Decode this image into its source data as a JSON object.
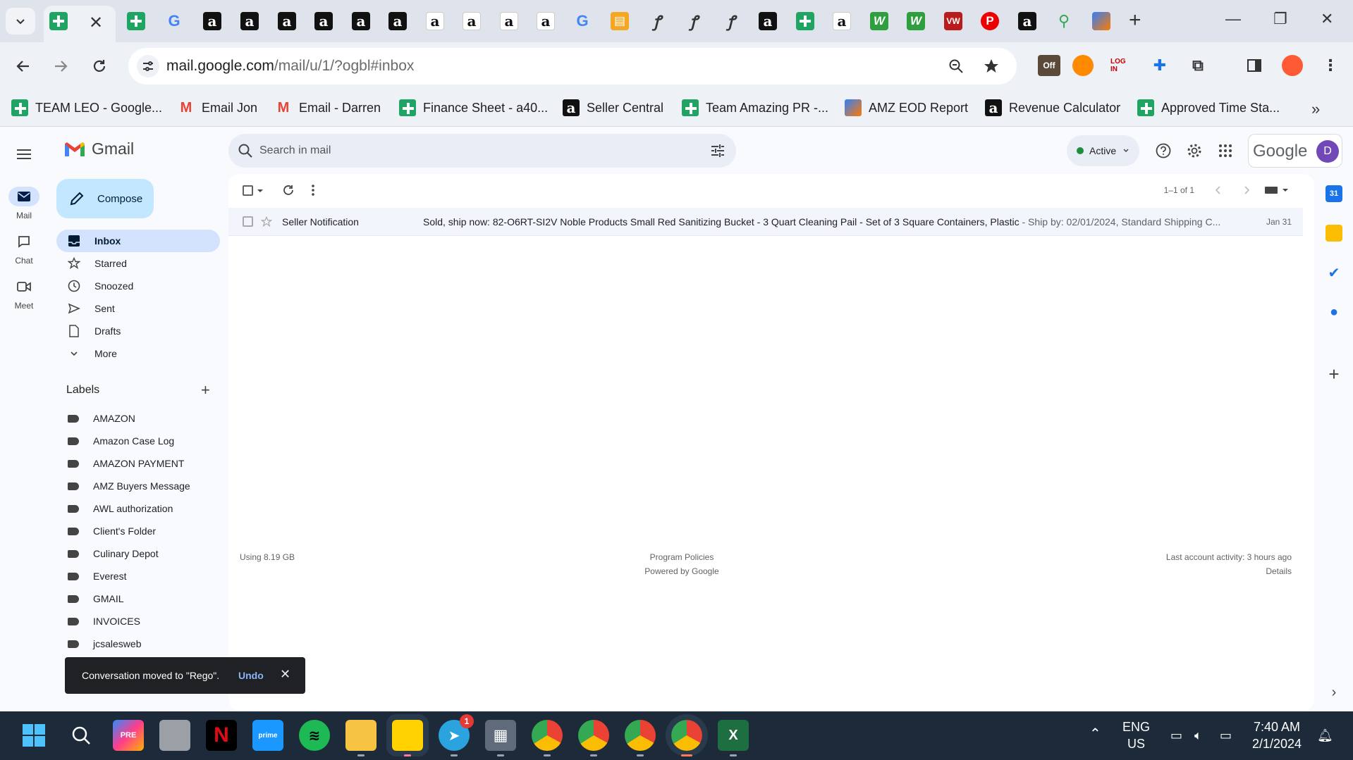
{
  "browser": {
    "url_host": "mail.google.com",
    "url_path": "/mail/u/1/?ogbl#inbox",
    "ext_off_label": "Off",
    "bookmarks": [
      {
        "label": "TEAM LEO - Google...",
        "icon": "sheets-icon"
      },
      {
        "label": "Email Jon",
        "icon": "gmail-icon"
      },
      {
        "label": "Email - Darren",
        "icon": "gmail-icon"
      },
      {
        "label": "Finance Sheet - a40...",
        "icon": "sheets-icon"
      },
      {
        "label": "Seller Central",
        "icon": "amazon-icon"
      },
      {
        "label": "Team Amazing PR -...",
        "icon": "sheets-icon"
      },
      {
        "label": "AMZ EOD Report",
        "icon": "clickup-icon"
      },
      {
        "label": "Revenue Calculator",
        "icon": "amazon-icon"
      },
      {
        "label": "Approved Time Sta...",
        "icon": "sheets-icon"
      }
    ]
  },
  "gmail": {
    "brand": "Gmail",
    "rail": [
      {
        "label": "Mail",
        "icon": "mail-icon"
      },
      {
        "label": "Chat",
        "icon": "chat-icon"
      },
      {
        "label": "Meet",
        "icon": "meet-icon"
      }
    ],
    "compose_label": "Compose",
    "nav": [
      {
        "label": "Inbox",
        "icon": "inbox-icon"
      },
      {
        "label": "Starred",
        "icon": "star-icon"
      },
      {
        "label": "Snoozed",
        "icon": "clock-icon"
      },
      {
        "label": "Sent",
        "icon": "send-icon"
      },
      {
        "label": "Drafts",
        "icon": "draft-icon"
      },
      {
        "label": "More",
        "icon": "chevron-down-icon"
      }
    ],
    "labels_heading": "Labels",
    "labels": [
      "AMAZON",
      "Amazon Case Log",
      "AMAZON PAYMENT",
      "AMZ Buyers Message",
      "AWL authorization",
      "Client's Folder",
      "Culinary Depot",
      "Everest",
      "GMAIL",
      "INVOICES",
      "jcsalesweb"
    ],
    "search_placeholder": "Search in mail",
    "status_label": "Active",
    "google_word": "Google",
    "avatar_letter": "D",
    "pager": "1–1 of 1",
    "emails": [
      {
        "sender": "Seller Notification",
        "subject": "Sold, ship now: 82-O6RT-SI2V Noble Products Small Red Sanitizing Bucket - 3 Quart Cleaning Pail - Set of 3 Square Containers, Plastic",
        "snippet": " - Ship by: 02/01/2024, Standard Shipping C...",
        "date": "Jan 31"
      }
    ],
    "footer": {
      "storage": "Using 8.19 GB",
      "policies": "Program Policies",
      "powered": "Powered by Google",
      "activity": "Last account activity: 3 hours ago",
      "details": "Details"
    },
    "toast": {
      "message": "Conversation moved to \"Rego\".",
      "undo": "Undo"
    }
  },
  "taskbar": {
    "badge_telegram": "1",
    "lang1": "ENG",
    "lang2": "US",
    "time": "7:40 AM",
    "date": "2/1/2024"
  },
  "colors": {
    "compose_bg": "#c2e7ff",
    "active_nav": "#d3e3fd",
    "avatar": "#7248b9",
    "status_dot": "#1e8e3e"
  }
}
